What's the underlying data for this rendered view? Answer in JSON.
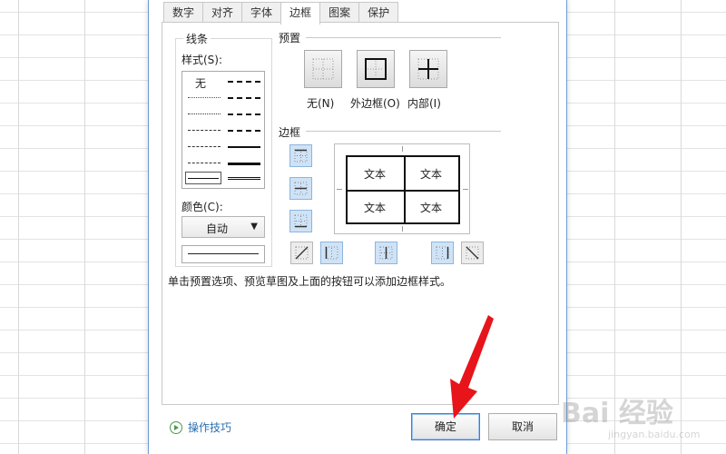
{
  "tabs": [
    {
      "label": "数字"
    },
    {
      "label": "对齐"
    },
    {
      "label": "字体"
    },
    {
      "label": "边框",
      "active": true
    },
    {
      "label": "图案"
    },
    {
      "label": "保护"
    }
  ],
  "line": {
    "title": "线条",
    "style_label": "样式(S):",
    "none_label": "无",
    "color_label": "颜色(C):",
    "color_value": "自动"
  },
  "preset": {
    "title": "预置",
    "items": [
      {
        "label": "无(N)"
      },
      {
        "label": "外边框(O)"
      },
      {
        "label": "内部(I)"
      }
    ]
  },
  "border": {
    "title": "边框",
    "cell_text": [
      "文本",
      "文本",
      "文本",
      "文本"
    ]
  },
  "hint": "单击预置选项、预览草图及上面的按钮可以添加边框样式。",
  "footer": {
    "tips": "操作技巧",
    "ok": "确定",
    "cancel": "取消"
  },
  "watermark": {
    "main": "Bai 经验",
    "sub": "jingyan.baidu.com"
  },
  "colors": {
    "accent": "#3c7fce",
    "arrow": "#e8141b",
    "selected_button": "#cfe3f7"
  }
}
